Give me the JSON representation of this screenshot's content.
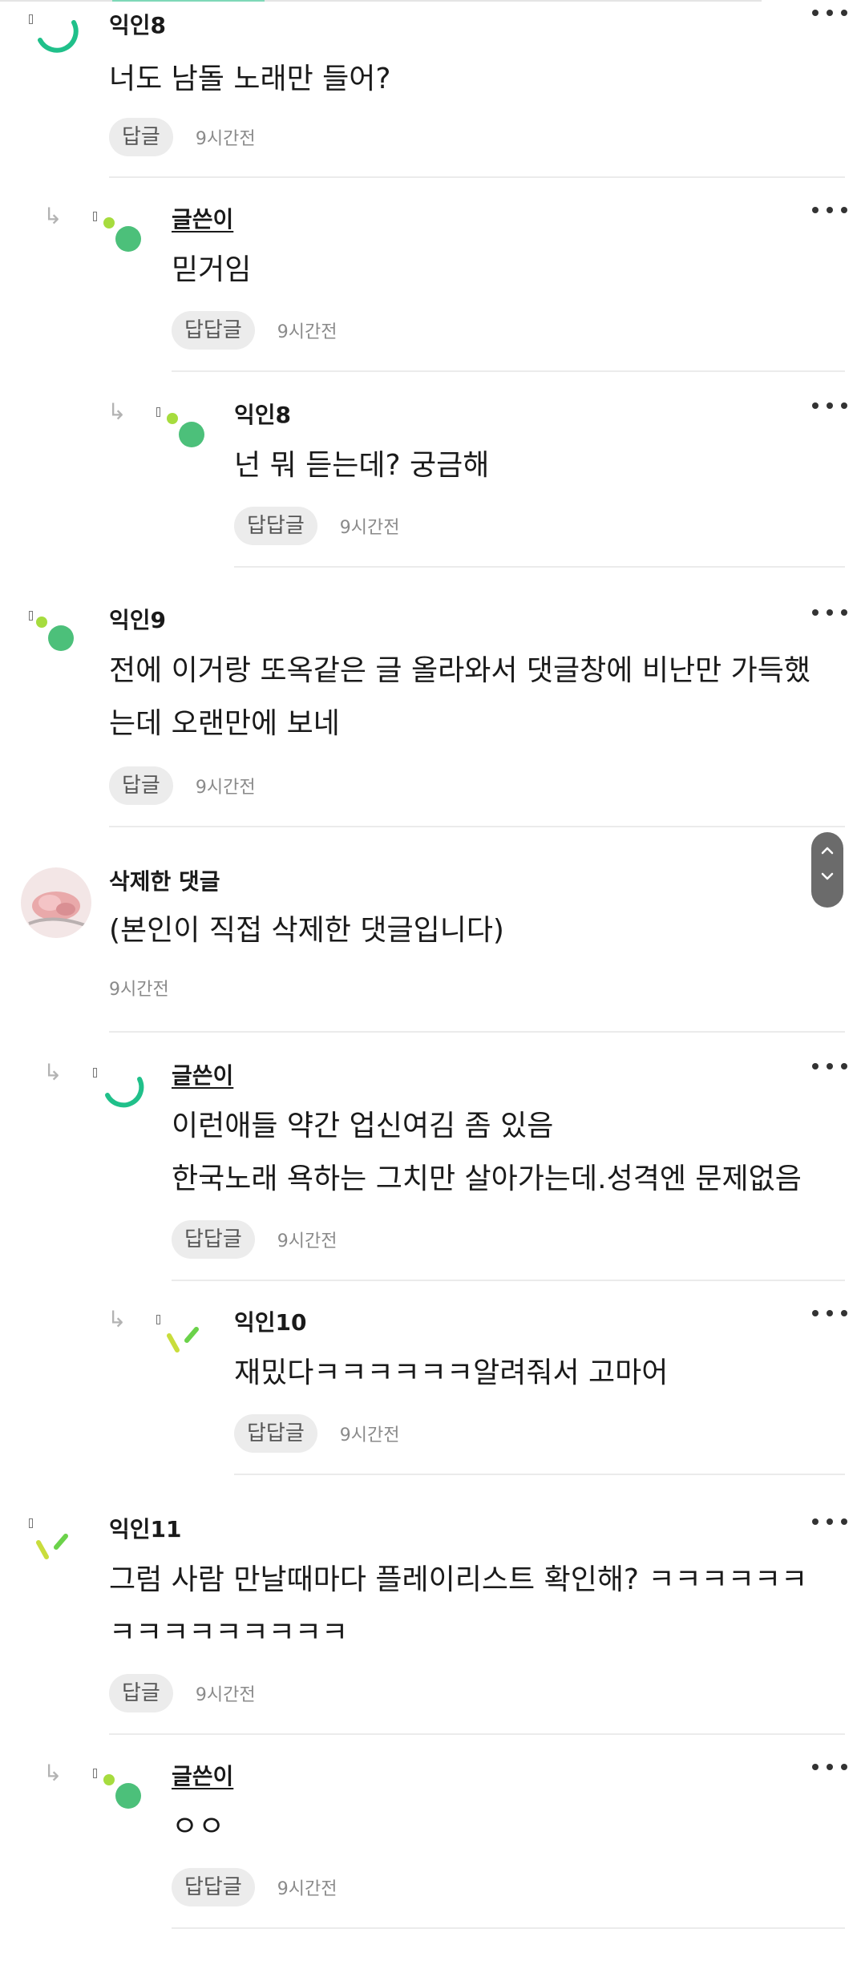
{
  "reply_label": "답글",
  "rereply_label": "답답글",
  "comments": [
    {
      "author": "익인8",
      "line1": "너도 남돌 노래만 들어?",
      "line2": "",
      "time": "9시간전"
    },
    {
      "author": "글쓴이",
      "line1": "믿거임",
      "line2": "",
      "time": "9시간전"
    },
    {
      "author": "익인8",
      "line1": "넌 뭐 듣는데? 궁금해",
      "line2": "",
      "time": "9시간전"
    },
    {
      "author": "익인9",
      "line1": "전에 이거랑 또옥같은 글 올라와서 댓글창에 비난만 가득했",
      "line2": "는데 오랜만에 보네",
      "time": "9시간전"
    },
    {
      "author": "삭제한 댓글",
      "line1": "(본인이 직접 삭제한 댓글입니다)",
      "line2": "",
      "time": "9시간전"
    },
    {
      "author": "글쓴이",
      "line1": "이런애들 약간 업신여김 좀 있음",
      "line2": "한국노래 욕하는 그치만 살아가는데.성격엔 문제없음",
      "time": "9시간전"
    },
    {
      "author": "익인10",
      "line1": "재밌다ㅋㅋㅋㅋㅋㅋ알려줘서 고마어",
      "line2": "",
      "time": "9시간전"
    },
    {
      "author": "익인11",
      "line1": "그럼 사람 만날때마다 플레이리스트 확인해? ㅋㅋㅋㅋㅋㅋ",
      "line2": "ㅋㅋㅋㅋㅋㅋㅋㅋㅋ",
      "time": "9시간전"
    },
    {
      "author": "글쓴이",
      "line1": "ㅇㅇ",
      "line2": "",
      "time": "9시간전"
    }
  ]
}
